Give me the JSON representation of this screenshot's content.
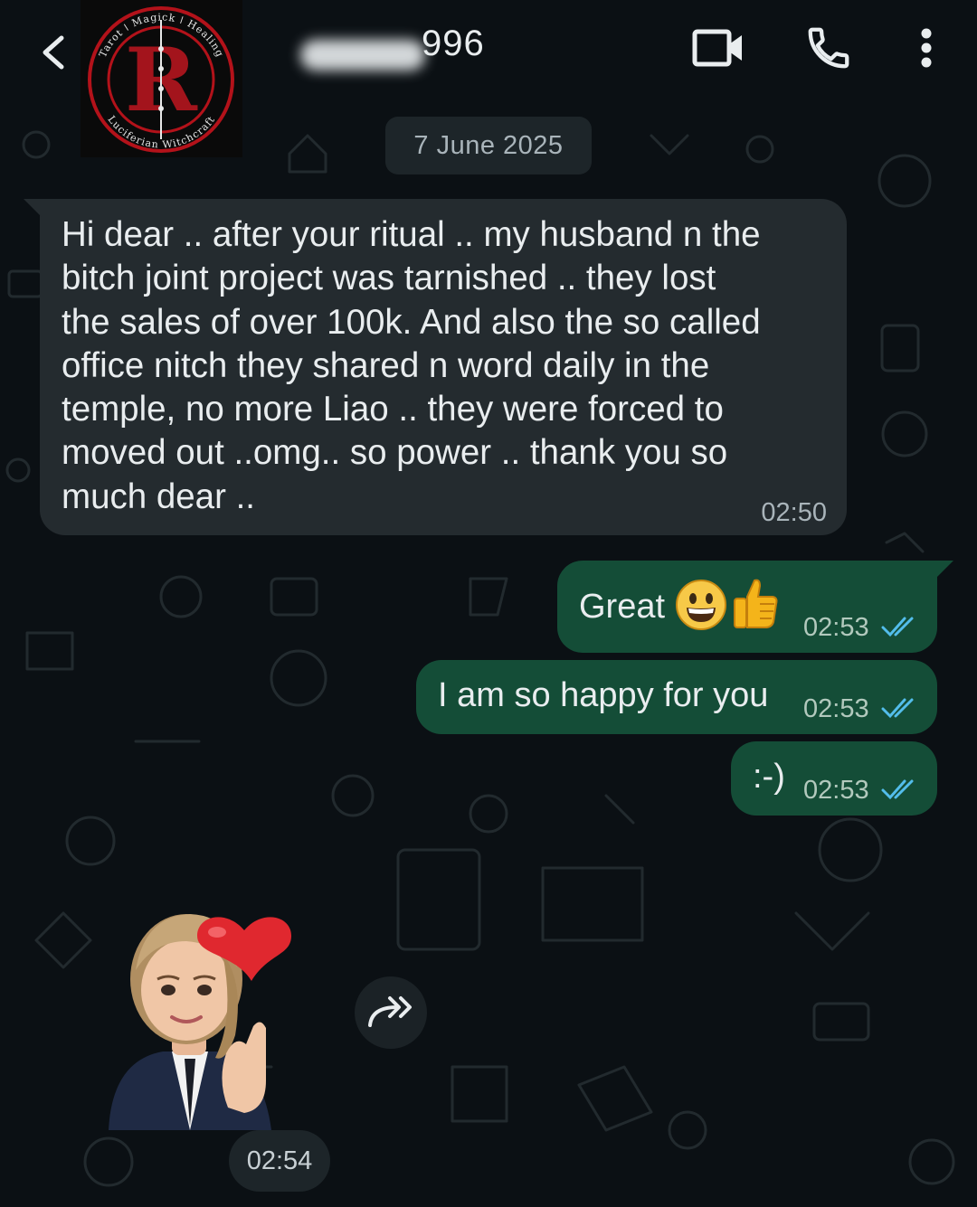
{
  "header": {
    "contact_name_visible": "996",
    "avatar_logo": {
      "letter": "R",
      "ring_text_top": "Tarot ǀ Magick ǀ Healing",
      "ring_text_bottom": "Luciferian Witchcraft"
    },
    "icons": [
      "back-arrow-icon",
      "video-camera-icon",
      "phone-icon",
      "more-vert-icon"
    ]
  },
  "date_chip": "7 June 2025",
  "messages": [
    {
      "direction": "incoming",
      "text": "Hi dear .. after your ritual .. my husband n the\nbitch joint project was tarnished .. they lost\nthe sales of over 100k.  And also the so called\noffice nitch they shared n word daily in the\ntemple, no more Liao .. they were forced to\nmoved out ..omg.. so power .. thank you so\nmuch dear ..",
      "time": "02:50"
    },
    {
      "direction": "outgoing",
      "text": "Great",
      "emojis": [
        "grinning-face",
        "thumbs-up"
      ],
      "time": "02:53",
      "status": "read"
    },
    {
      "direction": "outgoing",
      "text": "I am so happy for you",
      "time": "02:53",
      "status": "read"
    },
    {
      "direction": "outgoing",
      "text": ":-)",
      "time": "02:53",
      "status": "read"
    },
    {
      "direction": "incoming",
      "type": "sticker",
      "sticker": "avatar-finger-heart",
      "time": "02:54"
    }
  ],
  "colors": {
    "background": "#0b1014",
    "incoming_bubble": "#242b2f",
    "outgoing_bubble": "#144d37",
    "read_ticks": "#53bdeb",
    "logo_red": "#b3121a"
  }
}
